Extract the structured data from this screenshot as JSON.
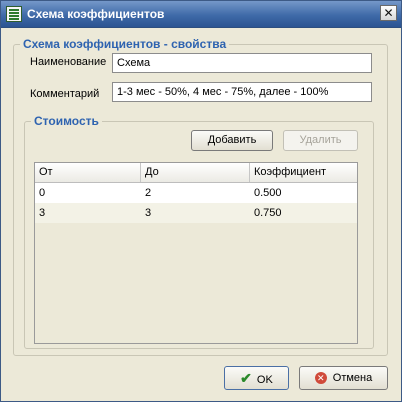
{
  "window": {
    "title": "Схема коэффициентов"
  },
  "properties": {
    "legend": "Схема коэффициентов - свойства",
    "name_label": "Наименование",
    "name_value": "Схема",
    "comment_label": "Комментарий",
    "comment_value": "1-3 мес - 50%, 4 мес - 75%, далее - 100%"
  },
  "cost": {
    "legend": "Стоимость",
    "add_label": "Добавить",
    "delete_label": "Удалить",
    "columns": [
      "От",
      "До",
      "Коэффициент"
    ],
    "rows": [
      [
        "0",
        "2",
        "0.500"
      ],
      [
        "3",
        "3",
        "0.750"
      ]
    ]
  },
  "footer": {
    "ok_label": "OK",
    "cancel_label": "Отмена"
  },
  "colors": {
    "titlebar": "#3f6aa8",
    "legend": "#2e63b0",
    "dialog_bg": "#ece9d8",
    "row_selected": "#ffffff",
    "row_alt": "#f3f2e6"
  },
  "icons": [
    "app-icon",
    "close-icon",
    "checkmark-icon",
    "cancel-icon"
  ]
}
